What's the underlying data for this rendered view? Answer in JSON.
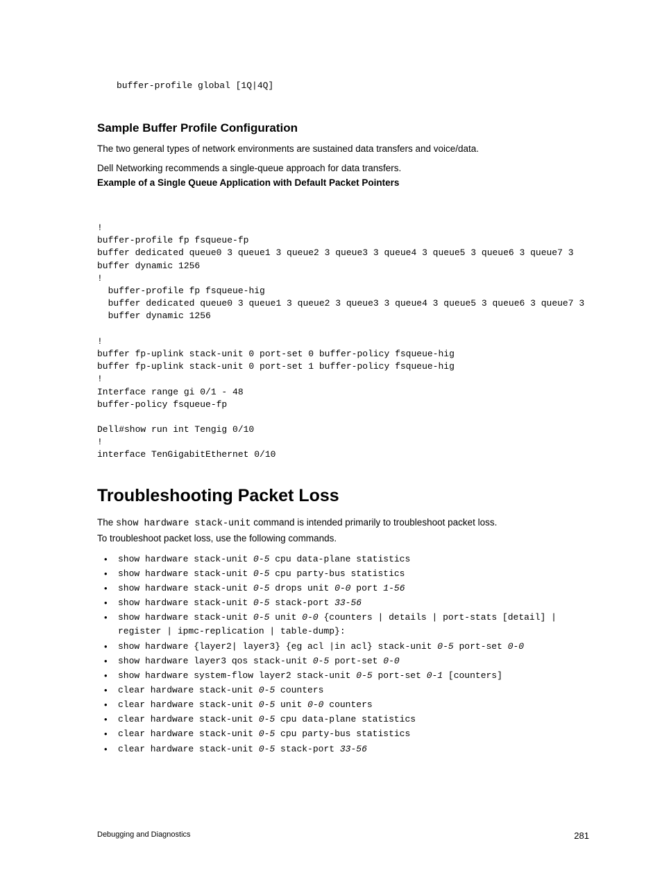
{
  "top_code": "buffer-profile global [1Q|4Q]",
  "heading_sample": "Sample Buffer Profile Configuration",
  "sample_para1": "The two general types of network environments are sustained data transfers and voice/data.",
  "sample_para2": "Dell Networking recommends a single-queue approach for data transfers.",
  "sample_bold": "Example of a Single Queue Application with Default Packet Pointers",
  "code_block": "\n!\nbuffer-profile fp fsqueue-fp\nbuffer dedicated queue0 3 queue1 3 queue2 3 queue3 3 queue4 3 queue5 3 queue6 3 queue7 3\nbuffer dynamic 1256\n!\n  buffer-profile fp fsqueue-hig\n  buffer dedicated queue0 3 queue1 3 queue2 3 queue3 3 queue4 3 queue5 3 queue6 3 queue7 3\n  buffer dynamic 1256\n\n!\nbuffer fp-uplink stack-unit 0 port-set 0 buffer-policy fsqueue-hig\nbuffer fp-uplink stack-unit 0 port-set 1 buffer-policy fsqueue-hig\n!\nInterface range gi 0/1 - 48\nbuffer-policy fsqueue-fp\n\nDell#show run int Tengig 0/10\n!\ninterface TenGigabitEthernet 0/10",
  "heading_troubleshoot": "Troubleshooting Packet Loss",
  "troubleshoot_para_pre": "The ",
  "troubleshoot_para_mono": "show hardware stack-unit",
  "troubleshoot_para_post": " command is intended primarily to troubleshoot packet loss.",
  "troubleshoot_para2": "To troubleshoot packet loss, use the following commands.",
  "commands": [
    {
      "segments": [
        {
          "t": "show hardware stack-unit "
        },
        {
          "t": "0-5",
          "i": true
        },
        {
          "t": " cpu data-plane statistics"
        }
      ]
    },
    {
      "segments": [
        {
          "t": "show hardware stack-unit "
        },
        {
          "t": "0-5",
          "i": true
        },
        {
          "t": " cpu party-bus statistics"
        }
      ]
    },
    {
      "segments": [
        {
          "t": "show hardware stack-unit "
        },
        {
          "t": "0-5",
          "i": true
        },
        {
          "t": " drops unit "
        },
        {
          "t": "0-0",
          "i": true
        },
        {
          "t": " port "
        },
        {
          "t": "1-56",
          "i": true
        }
      ]
    },
    {
      "segments": [
        {
          "t": "show hardware stack-unit "
        },
        {
          "t": "0-5",
          "i": true
        },
        {
          "t": " stack-port "
        },
        {
          "t": "33-56",
          "i": true
        }
      ]
    },
    {
      "segments": [
        {
          "t": "show hardware stack-unit "
        },
        {
          "t": "0-5",
          "i": true
        },
        {
          "t": " unit "
        },
        {
          "t": "0-0",
          "i": true
        },
        {
          "t": " {counters | details | port-stats [detail] | register | ipmc-replication | table-dump}:"
        }
      ]
    },
    {
      "segments": [
        {
          "t": "show hardware {layer2| layer3} {eg acl |in acl} stack-unit "
        },
        {
          "t": "0-5",
          "i": true
        },
        {
          "t": " port-set "
        },
        {
          "t": "0-0",
          "i": true
        }
      ]
    },
    {
      "segments": [
        {
          "t": "show hardware layer3 qos stack-unit "
        },
        {
          "t": "0-5",
          "i": true
        },
        {
          "t": " port-set "
        },
        {
          "t": "0-0",
          "i": true
        }
      ]
    },
    {
      "segments": [
        {
          "t": "show hardware system-flow layer2 stack-unit "
        },
        {
          "t": "0-5",
          "i": true
        },
        {
          "t": " port-set "
        },
        {
          "t": "0-1",
          "i": true
        },
        {
          "t": " [counters]"
        }
      ]
    },
    {
      "segments": [
        {
          "t": "clear hardware stack-unit "
        },
        {
          "t": "0-5",
          "i": true
        },
        {
          "t": " counters"
        }
      ]
    },
    {
      "segments": [
        {
          "t": "clear hardware stack-unit "
        },
        {
          "t": "0-5",
          "i": true
        },
        {
          "t": " unit "
        },
        {
          "t": "0-0",
          "i": true
        },
        {
          "t": " counters"
        }
      ]
    },
    {
      "segments": [
        {
          "t": "clear hardware stack-unit "
        },
        {
          "t": "0-5",
          "i": true
        },
        {
          "t": " cpu data-plane statistics"
        }
      ]
    },
    {
      "segments": [
        {
          "t": "clear hardware stack-unit "
        },
        {
          "t": "0-5",
          "i": true
        },
        {
          "t": " cpu party-bus statistics"
        }
      ]
    },
    {
      "segments": [
        {
          "t": "clear hardware stack-unit "
        },
        {
          "t": "0-5",
          "i": true
        },
        {
          "t": " stack-port "
        },
        {
          "t": "33-56",
          "i": true
        }
      ]
    }
  ],
  "footer_left": "Debugging and Diagnostics",
  "footer_right": "281"
}
